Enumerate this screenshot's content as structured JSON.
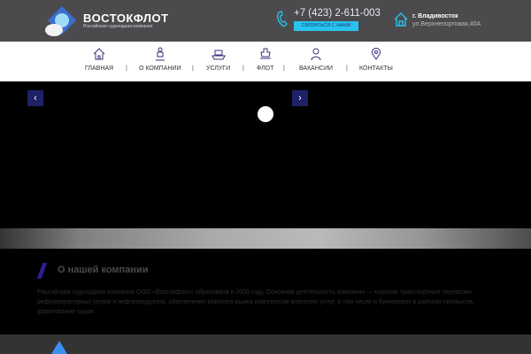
{
  "header": {
    "brand": "ВОСТОКФЛОТ",
    "brand_sub": "Российская судоходная компания",
    "phone": "+7 (423) 2-611-003",
    "contact_button": "СВЯЗАТЬСЯ С НАМИ",
    "city": "г. Владивосток",
    "address": "ул.Верхнепортовая,40А"
  },
  "nav": {
    "items": [
      {
        "label": "ГЛАВНАЯ"
      },
      {
        "label": "О КОМПАНИИ"
      },
      {
        "label": "УСЛУГИ"
      },
      {
        "label": "ФЛОТ"
      },
      {
        "label": "ВАКАНСИИ"
      },
      {
        "label": "КОНТАКТЫ"
      }
    ],
    "separator": "|"
  },
  "slider": {
    "prev": "‹",
    "next": "›"
  },
  "about": {
    "title": "О нашей компании",
    "text": "Российская судоходная компания ООО «Востокфлот» образована в 2006 году. Основная деятельность компании — морские транспортные перевозки рефрижераторных грузов и нефтепродуктов, обеспечение морского рынка комплексом агентских услуг, в том числе и бункеровок в районах промысла, фрахтование судов."
  },
  "colors": {
    "accent": "#29c3f0",
    "navy": "#1f2167",
    "header": "#4b4b4d"
  }
}
